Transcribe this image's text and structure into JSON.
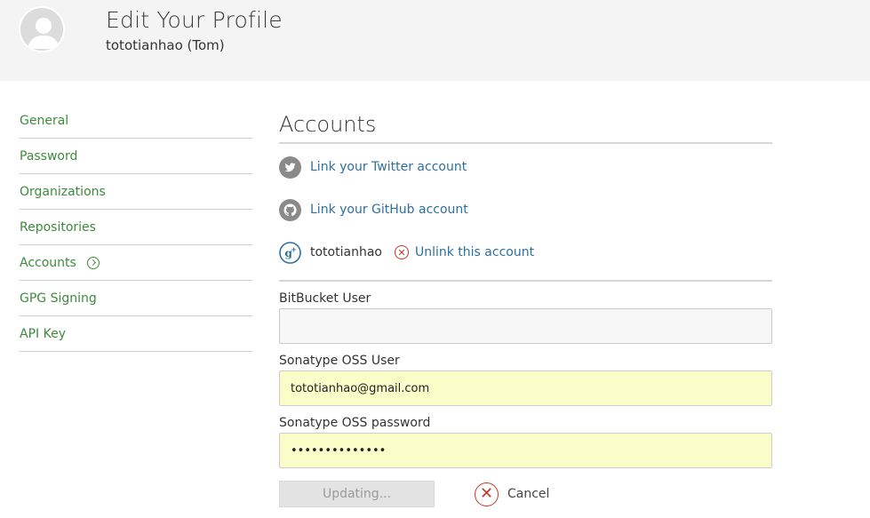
{
  "header": {
    "title": "Edit Your Profile",
    "subtitle": "tototianhao (Tom)"
  },
  "sidebar": {
    "items": [
      {
        "label": "General",
        "active": false
      },
      {
        "label": "Password",
        "active": false
      },
      {
        "label": "Organizations",
        "active": false
      },
      {
        "label": "Repositories",
        "active": false
      },
      {
        "label": "Accounts",
        "active": true
      },
      {
        "label": "GPG Signing",
        "active": false
      },
      {
        "label": "API Key",
        "active": false
      }
    ]
  },
  "accounts": {
    "title": "Accounts",
    "twitter_link": "Link your Twitter account",
    "github_link": "Link your GitHub account",
    "google_username": "tototianhao",
    "unlink_label": "Unlink this account"
  },
  "form": {
    "bitbucket_label": "BitBucket User",
    "bitbucket_value": "",
    "sonatype_user_label": "Sonatype OSS User",
    "sonatype_user_value": "tototianhao@gmail.com",
    "sonatype_password_label": "Sonatype OSS password",
    "sonatype_password_value": "••••••••••••••",
    "update_button": "Updating...",
    "cancel_label": "Cancel"
  },
  "colors": {
    "nav_green": "#3d8b3d",
    "link_blue": "#2e6f9e",
    "autofill_yellow": "#fafdc8",
    "danger_red": "#c0392b"
  },
  "icons": [
    "avatar",
    "arrow-right-icon",
    "twitter-icon",
    "github-icon",
    "google-plus-icon",
    "unlink-icon",
    "cancel-icon"
  ]
}
